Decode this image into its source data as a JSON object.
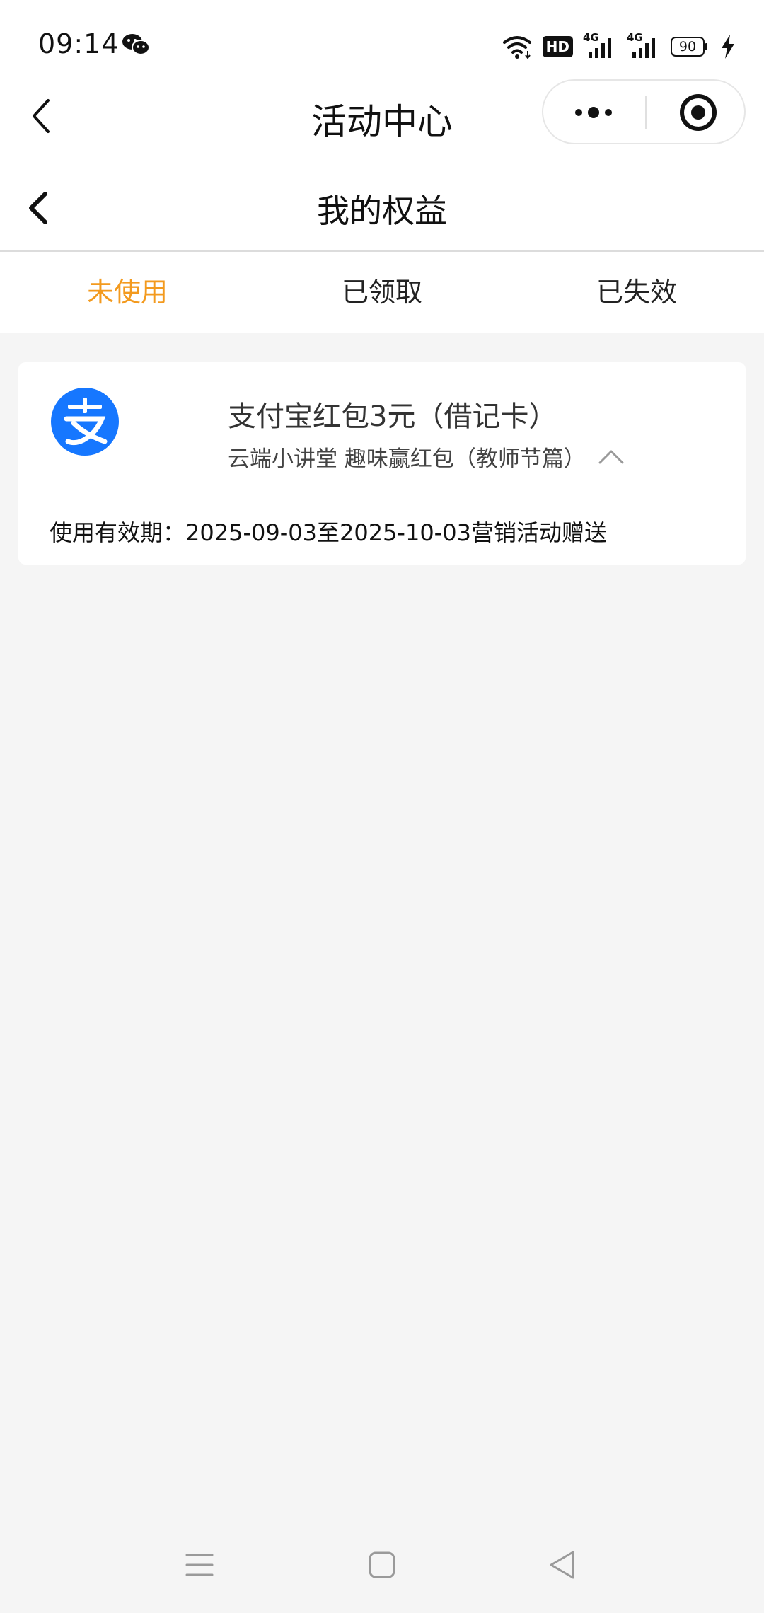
{
  "status_bar": {
    "time": "09:14",
    "hd_label": "HD",
    "signal_1_label": "4G",
    "signal_2_label": "4G",
    "battery_level": "90",
    "icons": [
      "wechat-icon",
      "wifi-icon",
      "signal-icon",
      "battery-icon",
      "charging-icon"
    ]
  },
  "mini_program": {
    "title": "活动中心",
    "icons": [
      "back-icon",
      "more-icon",
      "close-icon"
    ]
  },
  "page": {
    "title": "我的权益"
  },
  "tabs": [
    {
      "label": "未使用",
      "active": true
    },
    {
      "label": "已领取",
      "active": false
    },
    {
      "label": "已失效",
      "active": false
    }
  ],
  "colors": {
    "active_tab": "#f39a1e",
    "alipay_blue": "#1677ff",
    "background": "#f5f5f5"
  },
  "benefits": [
    {
      "title": "支付宝红包3元（借记卡）",
      "subtitle": "云端小讲堂 趣味赢红包（教师节篇）",
      "validity": "使用有效期：2025-09-03至2025-10-03营销活动赠送",
      "logo_icon": "alipay-logo-icon",
      "expanded": true
    }
  ],
  "nav_bar": {
    "icons": [
      "menu-icon",
      "home-icon",
      "back-icon"
    ]
  }
}
